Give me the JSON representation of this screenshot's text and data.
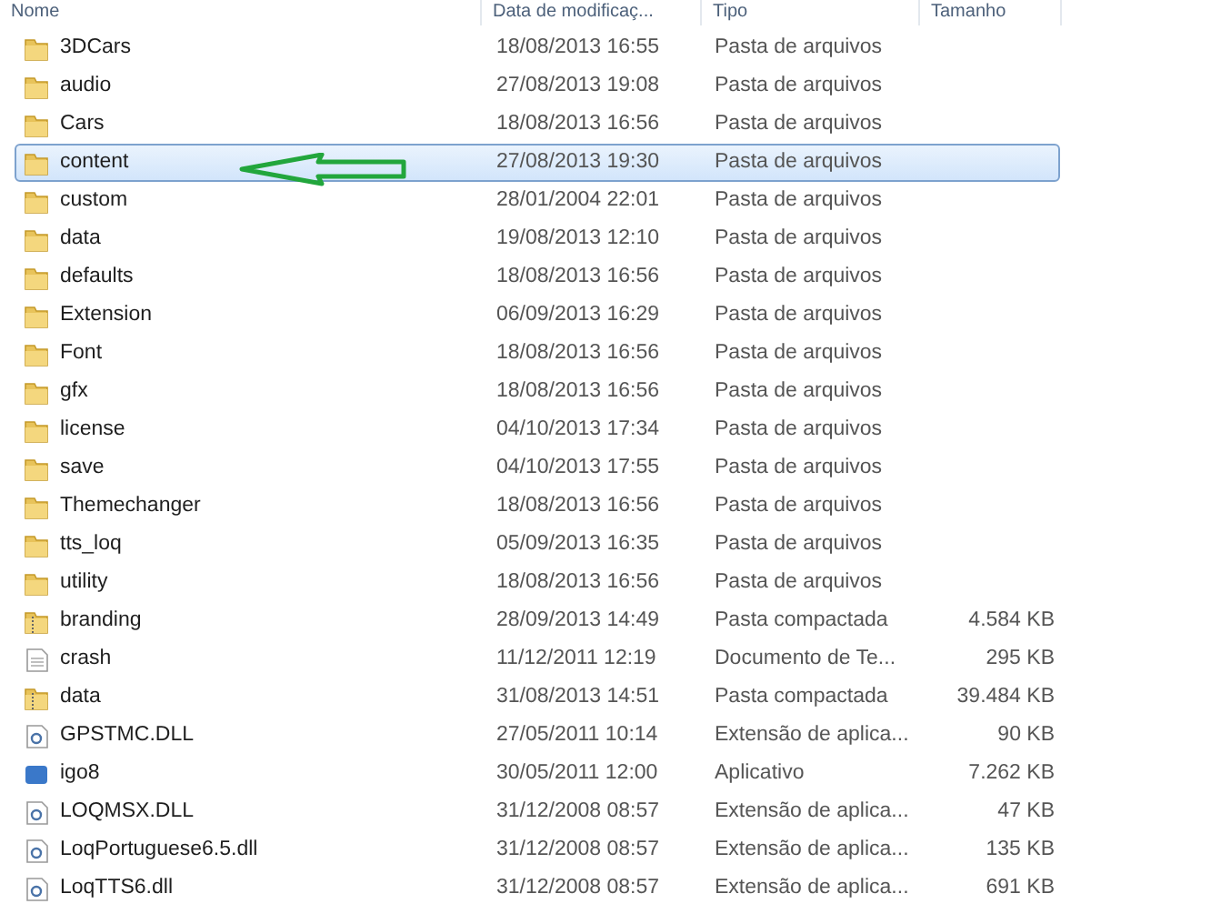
{
  "columns": [
    "Nome",
    "Data de modificaç...",
    "Tipo",
    "Tamanho"
  ],
  "rows": [
    {
      "kind": "folder",
      "name": "3DCars",
      "date": "18/08/2013 16:55",
      "type": "Pasta de arquivos",
      "selected": false
    },
    {
      "kind": "folder",
      "name": "audio",
      "date": "27/08/2013 19:08",
      "type": "Pasta de arquivos",
      "selected": false
    },
    {
      "kind": "folder",
      "name": "Cars",
      "date": "18/08/2013 16:56",
      "type": "Pasta de arquivos",
      "selected": false
    },
    {
      "kind": "folder",
      "name": "content",
      "date": "27/08/2013 19:30",
      "type": "Pasta de arquivos",
      "selected": true
    },
    {
      "kind": "folder",
      "name": "custom",
      "date": "28/01/2004 22:01",
      "type": "Pasta de arquivos",
      "selected": false
    },
    {
      "kind": "folder",
      "name": "data",
      "date": "19/08/2013 12:10",
      "type": "Pasta de arquivos",
      "selected": false
    },
    {
      "kind": "folder",
      "name": "defaults",
      "date": "18/08/2013 16:56",
      "type": "Pasta de arquivos",
      "selected": false
    },
    {
      "kind": "folder",
      "name": "Extension",
      "date": "06/09/2013 16:29",
      "type": "Pasta de arquivos",
      "selected": false
    },
    {
      "kind": "folder",
      "name": "Font",
      "date": "18/08/2013 16:56",
      "type": "Pasta de arquivos",
      "selected": false
    },
    {
      "kind": "folder",
      "name": "gfx",
      "date": "18/08/2013 16:56",
      "type": "Pasta de arquivos",
      "selected": false
    },
    {
      "kind": "folder",
      "name": "license",
      "date": "04/10/2013 17:34",
      "type": "Pasta de arquivos",
      "selected": false
    },
    {
      "kind": "folder",
      "name": "save",
      "date": "04/10/2013 17:55",
      "type": "Pasta de arquivos",
      "selected": false
    },
    {
      "kind": "folder",
      "name": "Themechanger",
      "date": "18/08/2013 16:56",
      "type": "Pasta de arquivos",
      "selected": false
    },
    {
      "kind": "folder",
      "name": "tts_loq",
      "date": "05/09/2013 16:35",
      "type": "Pasta de arquivos",
      "selected": false
    },
    {
      "kind": "folder",
      "name": "utility",
      "date": "18/08/2013 16:56",
      "type": "Pasta de arquivos",
      "selected": false
    },
    {
      "kind": "zip",
      "name": "branding",
      "date": "28/09/2013 14:49",
      "type": "Pasta compactada",
      "size": "4.584 KB",
      "selected": false
    },
    {
      "kind": "text",
      "name": "crash",
      "date": "11/12/2011 12:19",
      "type": "Documento de Te...",
      "size": "295 KB",
      "selected": false
    },
    {
      "kind": "zip",
      "name": "data",
      "date": "31/08/2013 14:51",
      "type": "Pasta compactada",
      "size": "39.484 KB",
      "selected": false
    },
    {
      "kind": "dll",
      "name": "GPSTMC.DLL",
      "date": "27/05/2011 10:14",
      "type": "Extensão de aplica...",
      "size": "90 KB",
      "selected": false
    },
    {
      "kind": "app",
      "name": "igo8",
      "date": "30/05/2011 12:00",
      "type": "Aplicativo",
      "size": "7.262 KB",
      "selected": false
    },
    {
      "kind": "dll",
      "name": "LOQMSX.DLL",
      "date": "31/12/2008 08:57",
      "type": "Extensão de aplica...",
      "size": "47 KB",
      "selected": false
    },
    {
      "kind": "dll",
      "name": "LoqPortuguese6.5.dll",
      "date": "31/12/2008 08:57",
      "type": "Extensão de aplica...",
      "size": "135 KB",
      "selected": false
    },
    {
      "kind": "dll",
      "name": "LoqTTS6.dll",
      "date": "31/12/2008 08:57",
      "type": "Extensão de aplica...",
      "size": "691 KB",
      "selected": false
    }
  ]
}
